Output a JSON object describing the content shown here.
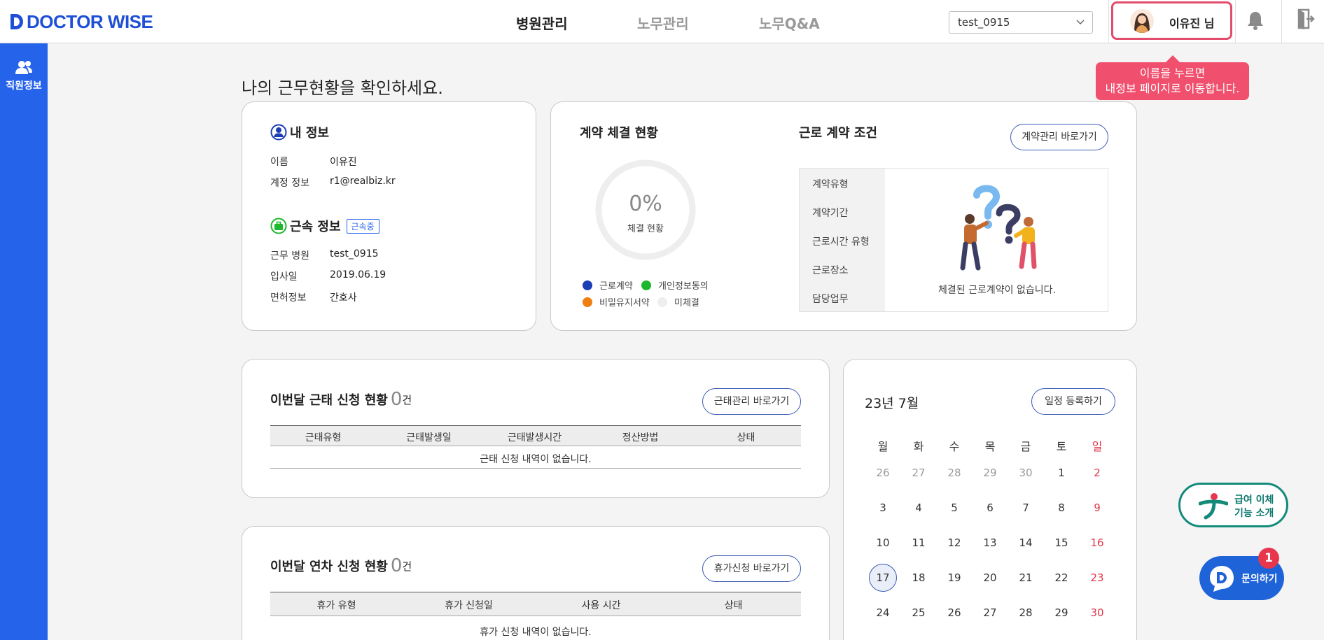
{
  "header": {
    "logo_text": "DOCTOR WISE",
    "nav": [
      {
        "label": "병원관리",
        "active": true
      },
      {
        "label": "노무관리",
        "active": false
      },
      {
        "label": "노무Q&A",
        "active": false
      }
    ],
    "hospital_select": "test_0915",
    "user_name": "이유진 님",
    "tooltip_line1": "이름을 누르면",
    "tooltip_line2": "내정보 페이지로 이동합니다."
  },
  "sidebar": {
    "items": [
      {
        "label": "직원정보",
        "icon": "users-icon"
      }
    ]
  },
  "page_title": "나의 근무현황을 확인하세요.",
  "my_info": {
    "title": "내 정보",
    "rows": [
      {
        "label": "이름",
        "value": "이유진"
      },
      {
        "label": "계정 정보",
        "value": "r1@realbiz.kr"
      }
    ]
  },
  "employment": {
    "title": "근속 정보",
    "badge": "근속중",
    "rows": [
      {
        "label": "근무 병원",
        "value": "test_0915"
      },
      {
        "label": "입사일",
        "value": "2019.06.19"
      },
      {
        "label": "면허정보",
        "value": "간호사"
      }
    ]
  },
  "contract_status": {
    "title": "계약 체결 현황",
    "percent": "0%",
    "sub": "체결 현황",
    "progress": 0,
    "legend": [
      {
        "label": "근로계약",
        "color": "#1a3fb5"
      },
      {
        "label": "개인정보동의",
        "color": "#1db82b"
      },
      {
        "label": "비밀유지서약",
        "color": "#f07d10"
      },
      {
        "label": "미체결",
        "color": "#eeeeee"
      }
    ]
  },
  "contract_terms": {
    "title": "근로 계약 조건",
    "button": "계약관리 바로가기",
    "labels": [
      "계약유형",
      "계약기간",
      "근로시간 유형",
      "근로장소",
      "담당업무"
    ],
    "empty": "체결된 근로계약이 없습니다."
  },
  "attendance": {
    "title": "이번달 근태 신청 현황",
    "count": "0",
    "unit": "건",
    "button": "근태관리 바로가기",
    "columns": [
      "근태유형",
      "근태발생일",
      "근태발생시간",
      "정산방법",
      "상태"
    ],
    "empty": "근태 신청 내역이 없습니다."
  },
  "leave": {
    "title": "이번달 연차 신청 현황",
    "count": "0",
    "unit": "건",
    "button": "휴가신청 바로가기",
    "columns": [
      "휴가 유형",
      "휴가 신청일",
      "사용 시간",
      "상태"
    ],
    "empty": "휴가 신청 내역이 없습니다."
  },
  "calendar": {
    "title": "23년 7월",
    "button": "일정 등록하기",
    "dow": [
      "월",
      "화",
      "수",
      "목",
      "금",
      "토",
      "일"
    ],
    "weeks": [
      [
        "26",
        "27",
        "28",
        "29",
        "30",
        "1",
        "2"
      ],
      [
        "3",
        "4",
        "5",
        "6",
        "7",
        "8",
        "9"
      ],
      [
        "10",
        "11",
        "12",
        "13",
        "14",
        "15",
        "16"
      ],
      [
        "17",
        "18",
        "19",
        "20",
        "21",
        "22",
        "23"
      ],
      [
        "24",
        "25",
        "26",
        "27",
        "28",
        "29",
        "30"
      ]
    ],
    "today": "17",
    "sunday_color": "#e0364a"
  },
  "floating": {
    "salary_line1": "급여 이체",
    "salary_line2": "기능 소개",
    "ask_label": "문의하기",
    "ask_badge": "1"
  }
}
